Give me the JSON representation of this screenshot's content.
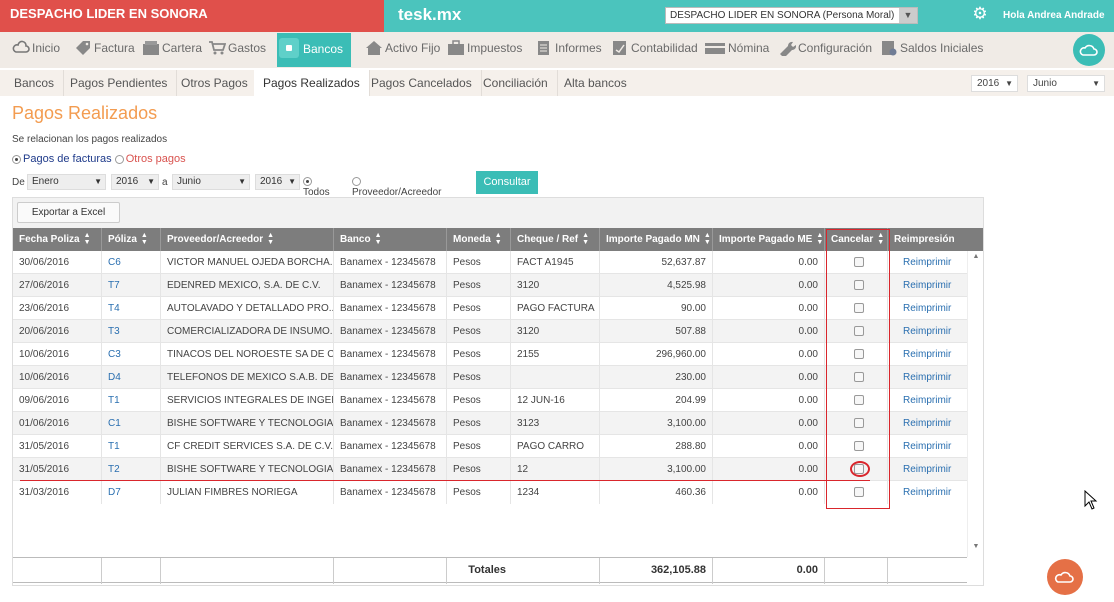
{
  "topbar": {
    "company": "DESPACHO LIDER EN SONORA",
    "brand": "tesk.mx",
    "company_select": "DESPACHO LIDER EN SONORA (Persona Moral)",
    "greeting": "Hola Andrea Andrade",
    "accent": "#4bc4bd",
    "company_bg": "#e0504b"
  },
  "mainnav": {
    "items": [
      {
        "label": "Inicio",
        "icon": "cloud-icon"
      },
      {
        "label": "Factura",
        "icon": "tag-icon"
      },
      {
        "label": "Cartera",
        "icon": "folder-icon"
      },
      {
        "label": "Gastos",
        "icon": "cart-icon"
      },
      {
        "label": "Bancos",
        "icon": "safe-icon"
      },
      {
        "label": "Activo Fijo",
        "icon": "house-icon"
      },
      {
        "label": "Impuestos",
        "icon": "briefcase-icon"
      },
      {
        "label": "Informes",
        "icon": "document-icon"
      },
      {
        "label": "Contabilidad",
        "icon": "ledger-icon"
      },
      {
        "label": "Nómina",
        "icon": "card-icon"
      },
      {
        "label": "Configuración",
        "icon": "wrench-icon"
      },
      {
        "label": "Saldos Iniciales",
        "icon": "calculator-icon"
      }
    ]
  },
  "subnav": {
    "tabs": [
      "Bancos",
      "Pagos Pendientes",
      "Otros Pagos",
      "Pagos Realizados",
      "Pagos Cancelados",
      "Conciliación",
      "Alta bancos"
    ],
    "year": "2016",
    "month": "Junio"
  },
  "page": {
    "title": "Pagos Realizados",
    "subtitle": "Se relacionan los pagos realizados",
    "opt_facturas": "Pagos de facturas",
    "opt_otros": "Otros pagos",
    "de_label": "De",
    "a_label": "a",
    "from_month": "Enero",
    "from_year": "2016",
    "to_month": "Junio",
    "to_year": "2016",
    "opt_todos": "Todos",
    "opt_proveedor": "Proveedor/Acreedor",
    "consultar": "Consultar",
    "export": "Exportar a Excel"
  },
  "table": {
    "headers": [
      "Fecha Poliza",
      "Póliza",
      "Proveedor/Acreedor",
      "Banco",
      "Moneda",
      "Cheque / Ref",
      "Importe Pagado MN",
      "Importe Pagado ME",
      "Cancelar",
      "Reimpresión"
    ],
    "rows": [
      [
        "30/06/2016",
        "C6",
        "VICTOR MANUEL OJEDA BORCHA...",
        "Banamex - 12345678",
        "Pesos",
        "FACT A1945",
        "52,637.87",
        "0.00",
        "",
        "Reimprimir"
      ],
      [
        "27/06/2016",
        "T7",
        "EDENRED MEXICO, S.A. DE C.V.",
        "Banamex - 12345678",
        "Pesos",
        "3120",
        "4,525.98",
        "0.00",
        "",
        "Reimprimir"
      ],
      [
        "23/06/2016",
        "T4",
        "AUTOLAVADO Y DETALLADO PRO...",
        "Banamex - 12345678",
        "Pesos",
        "PAGO FACTURA",
        "90.00",
        "0.00",
        "",
        "Reimprimir"
      ],
      [
        "20/06/2016",
        "T3",
        "COMERCIALIZADORA DE INSUMO...",
        "Banamex - 12345678",
        "Pesos",
        "3120",
        "507.88",
        "0.00",
        "",
        "Reimprimir"
      ],
      [
        "10/06/2016",
        "C3",
        "TINACOS DEL NOROESTE SA DE CV",
        "Banamex - 12345678",
        "Pesos",
        "2155",
        "296,960.00",
        "0.00",
        "",
        "Reimprimir"
      ],
      [
        "10/06/2016",
        "D4",
        "TELEFONOS DE MEXICO S.A.B. DE...",
        "Banamex - 12345678",
        "Pesos",
        "",
        "230.00",
        "0.00",
        "",
        "Reimprimir"
      ],
      [
        "09/06/2016",
        "T1",
        "SERVICIOS INTEGRALES DE INGEN...",
        "Banamex - 12345678",
        "Pesos",
        "12 JUN-16",
        "204.99",
        "0.00",
        "",
        "Reimprimir"
      ],
      [
        "01/06/2016",
        "C1",
        "BISHE SOFTWARE Y TECNOLOGIA...",
        "Banamex - 12345678",
        "Pesos",
        "3123",
        "3,100.00",
        "0.00",
        "",
        "Reimprimir"
      ],
      [
        "31/05/2016",
        "T1",
        "CF CREDIT SERVICES S.A. DE C.V. S...",
        "Banamex - 12345678",
        "Pesos",
        "PAGO CARRO",
        "288.80",
        "0.00",
        "",
        "Reimprimir"
      ],
      [
        "31/05/2016",
        "T2",
        "BISHE SOFTWARE Y TECNOLOGIA...",
        "Banamex - 12345678",
        "Pesos",
        "12",
        "3,100.00",
        "0.00",
        "",
        "Reimprimir"
      ],
      [
        "31/03/2016",
        "D7",
        "JULIAN FIMBRES NORIEGA",
        "Banamex - 12345678",
        "Pesos",
        "1234",
        "460.36",
        "0.00",
        "",
        "Reimprimir"
      ]
    ],
    "totals_label": "Totales",
    "total_mn": "362,105.88",
    "total_me": "0.00"
  }
}
